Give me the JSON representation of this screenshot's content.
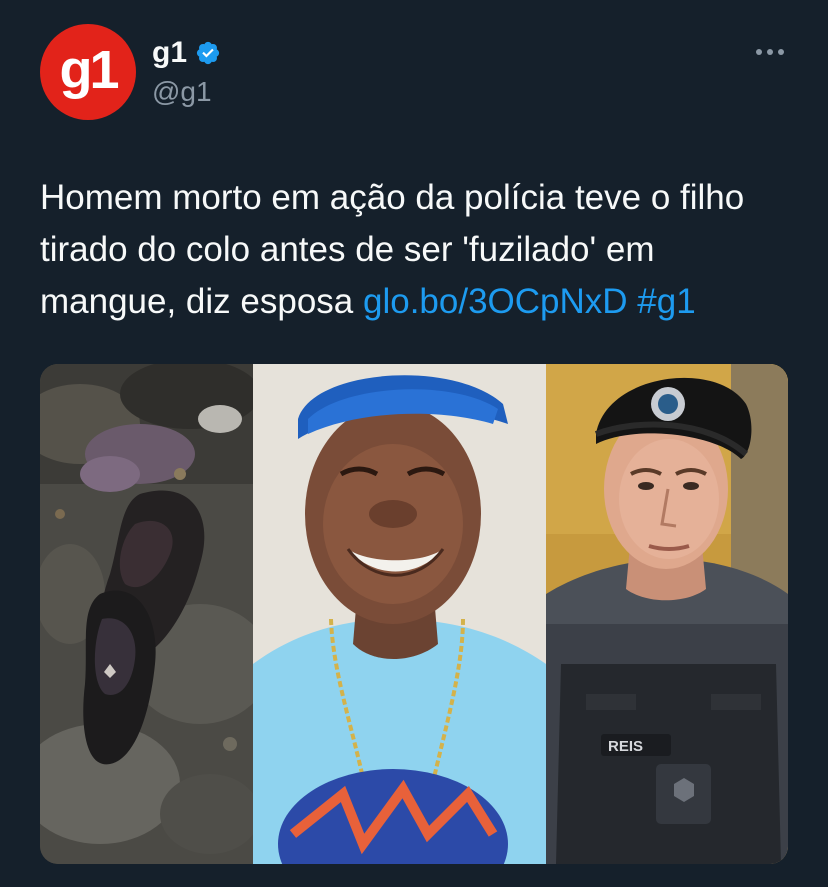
{
  "author": {
    "avatar_text": "g1",
    "display_name": "g1",
    "handle": "@g1",
    "verified": true
  },
  "icons": {
    "verified": "verified-badge-icon",
    "more": "more-options-icon"
  },
  "tweet": {
    "text": "Homem morto em ação da polícia teve o filho tirado do colo antes de ser 'fuzilado' em mangue, diz esposa ",
    "link": "glo.bo/3OCpNxD",
    "hashtag": "#g1"
  },
  "media": {
    "image_count": 3,
    "name_tag": "REIS"
  },
  "colors": {
    "background": "#15202b",
    "text": "#f7f9f9",
    "secondary_text": "#8b98a5",
    "link": "#1d9bf0",
    "brand_red": "#e2231a"
  }
}
